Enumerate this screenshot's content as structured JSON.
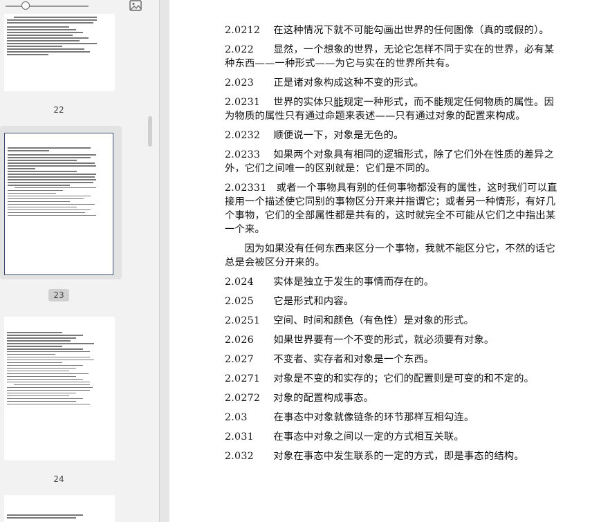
{
  "sidebar": {
    "image_icon": "image-icon",
    "thumbnails": [
      {
        "page_label": "22",
        "active": false
      },
      {
        "page_label": "23",
        "active": true
      },
      {
        "page_label": "24",
        "active": false
      }
    ]
  },
  "document": {
    "paragraphs": [
      {
        "num": "2.0212",
        "text": "在这种情况下就不可能勾画出世界的任何图像（真的或假的）。"
      },
      {
        "num": "2.022",
        "text": "显然，一个想象的世界，无论它怎样不同于实在的世界，必有某种东西——一种形式——为它与实在的世界所共有。"
      },
      {
        "num": "2.023",
        "text": "正是诸对象构成这种不变的形式。"
      },
      {
        "num": "2.0231",
        "text_pre": "世界的实体只",
        "text_ul": "能",
        "text_post": "规定一种形式，而不能规定任何物质的属性。因为物质的属性只有通过命题来表述——只有通过对象的配置来构成。"
      },
      {
        "num": "2.0232",
        "text": "顺便说一下，对象是无色的。"
      },
      {
        "num": "2.0233",
        "text": "如果两个对象具有相同的逻辑形式，除了它们外在性质的差异之外，它们之间唯一的区别就是：它们是不同的。"
      },
      {
        "num": "2.02331",
        "text": "或者一个事物具有别的任何事物都没有的属性，这时我们可以直接用一个描述使它同别的事物区分开来并指谓它；或者另一种情形，有好几个事物，它们的全部属性都是共有的，这时就完全不可能从它们之中指出某一个来。"
      },
      {
        "num": "",
        "text": "因为如果没有任何东西来区分一个事物，我就不能区分它，不然的话它总是会被区分开来的。"
      },
      {
        "num": "2.024",
        "text": "实体是独立于发生的事情而存在的。"
      },
      {
        "num": "2.025",
        "text": "它是形式和内容。"
      },
      {
        "num": "2.0251",
        "text": "空间、时间和颜色（有色性）是对象的形式。"
      },
      {
        "num": "2.026",
        "text": "如果世界要有一个不变的形式，就必须要有对象。"
      },
      {
        "num": "2.027",
        "text": "不变者、实存者和对象是一个东西。"
      },
      {
        "num": "2.0271",
        "text": "对象是不变的和实存的；它们的配置则是可变的和不定的。"
      },
      {
        "num": "2.0272",
        "text": "对象的配置构成事态。"
      },
      {
        "num": "2.03",
        "text": "在事态中对象就像链条的环节那样互相勾连。"
      },
      {
        "num": "2.031",
        "text": "在事态中对象之间以一定的方式相互关联。"
      },
      {
        "num": "2.032",
        "text": "对象在事态中发生联系的一定的方式，即是事态的结构。"
      }
    ]
  }
}
